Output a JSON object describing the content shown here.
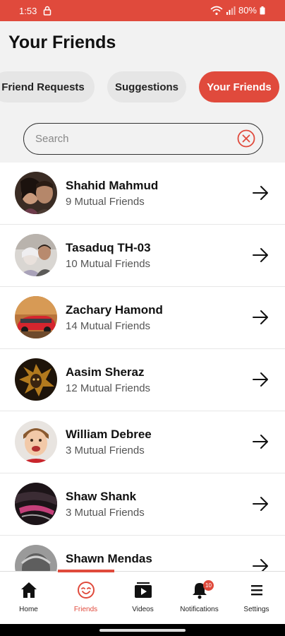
{
  "status": {
    "time": "1:53",
    "battery": "80%"
  },
  "header": {
    "title": "Your Friends"
  },
  "tabs": [
    {
      "label": "Friend Requests",
      "active": false
    },
    {
      "label": "Suggestions",
      "active": false
    },
    {
      "label": "Your Friends",
      "active": true
    }
  ],
  "search": {
    "placeholder": "Search",
    "value": ""
  },
  "friends": [
    {
      "name": "Shahid Mahmud",
      "mutual": "9 Mutual Friends"
    },
    {
      "name": "Tasaduq TH-03",
      "mutual": "10 Mutual Friends"
    },
    {
      "name": "Zachary Hamond",
      "mutual": "14 Mutual Friends"
    },
    {
      "name": "Aasim Sheraz",
      "mutual": "12 Mutual Friends"
    },
    {
      "name": "William Debree",
      "mutual": "3 Mutual Friends"
    },
    {
      "name": "Shaw Shank",
      "mutual": "3 Mutual Friends"
    },
    {
      "name": "Shawn Mendas",
      "mutual": ""
    }
  ],
  "nav": {
    "items": [
      {
        "label": "Home",
        "icon": "home-icon"
      },
      {
        "label": "Friends",
        "icon": "friends-icon",
        "active": true
      },
      {
        "label": "Videos",
        "icon": "videos-icon"
      },
      {
        "label": "Notifications",
        "icon": "bell-icon",
        "badge": "10"
      },
      {
        "label": "Settings",
        "icon": "menu-icon"
      }
    ]
  },
  "colors": {
    "accent": "#e04a3c",
    "background": "#f2f2f2"
  }
}
